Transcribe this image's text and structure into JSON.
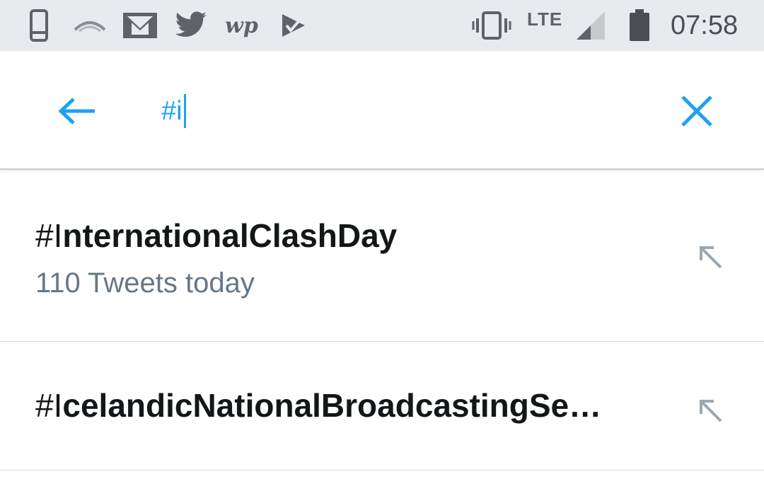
{
  "status_bar": {
    "icons": [
      "phone-icon",
      "signal-arc-icon",
      "gmail-icon",
      "twitter-icon",
      "washington-post-icon",
      "check-flag-icon",
      "vibrate-icon",
      "cell-signal-icon",
      "battery-icon"
    ],
    "network": "LTE",
    "time": "07:58"
  },
  "search": {
    "query": "#i",
    "accent_color": "#1da1f2"
  },
  "suggestions": [
    {
      "prefix": "#I",
      "rest": "nternationalClashDay",
      "subtitle": "110 Tweets today"
    },
    {
      "prefix": "#I",
      "rest": "celandicNationalBroadcastingSe…"
    }
  ]
}
